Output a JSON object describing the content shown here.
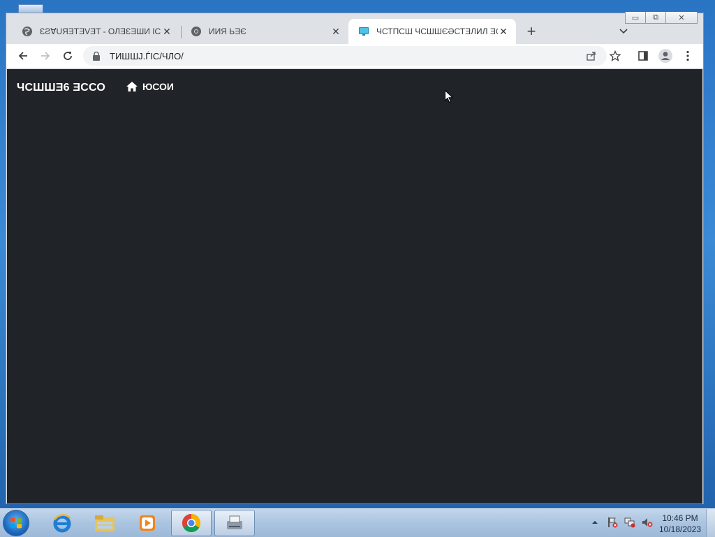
{
  "browser": {
    "tabs": [
      {
        "title": "ƐƧⱯUЯƎTƎVƎT - ОЛƎƐƎШИ ІС ШСƎƏ",
        "icon": "globe-icon",
        "active": false
      },
      {
        "title": "ИИЯ ЬƎЄ",
        "icon": "chrome-logo-icon",
        "active": false
      },
      {
        "title": "ЧСТПСШ ЧСШШЄƏСТƎЛИЛ ƎССО,",
        "icon": "monitor-icon",
        "active": true
      }
    ],
    "address": {
      "url": "ТИШШЈ.ЃІС/ЧЛО/"
    },
    "window_buttons": {
      "minimize": "▭",
      "restore": "⧉",
      "close": "✕"
    }
  },
  "page": {
    "brand": "ЧСШШƎ6 ƎССО",
    "home_link": "ЮСОИ"
  },
  "taskbar": {
    "pinned": [
      "internet-explorer-icon",
      "file-explorer-icon",
      "media-player-icon",
      "chrome-icon",
      "network-fax-icon"
    ],
    "clock": {
      "time": "10:46 PM",
      "date": "10/18/2023"
    }
  },
  "colors": {
    "page_background": "#202328",
    "tab_strip": "#dee1e6",
    "active_tab": "#ffffff",
    "taskbar": "#aac4e0"
  }
}
